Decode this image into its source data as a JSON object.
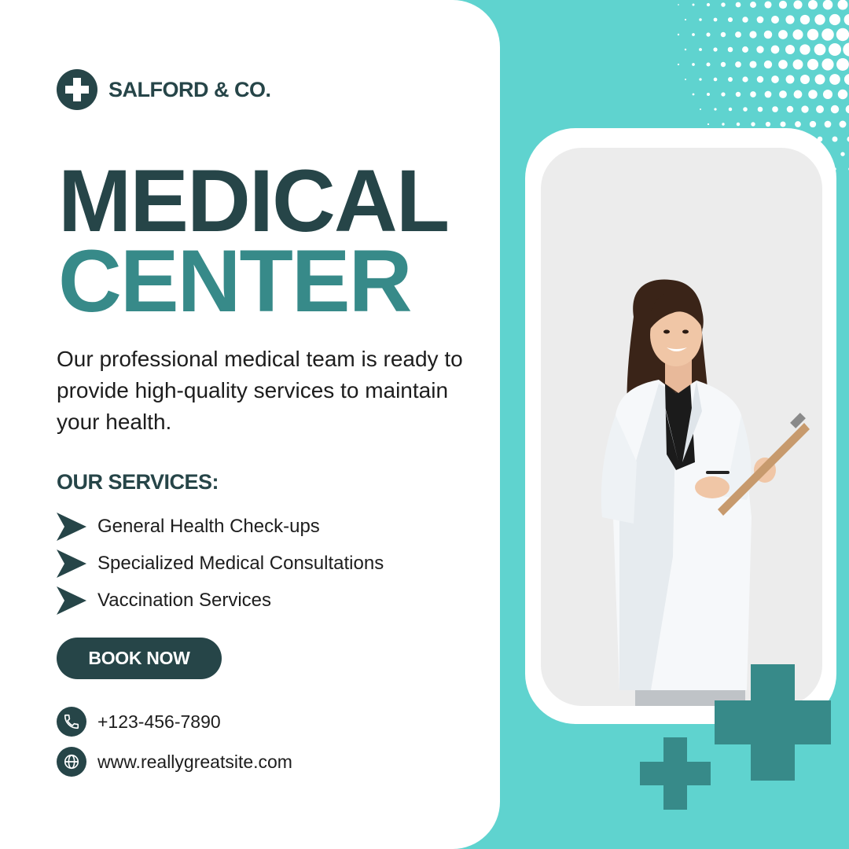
{
  "brand": {
    "name": "SALFORD & CO.",
    "logo_icon": "medical-cross-icon"
  },
  "hero": {
    "title_line1": "MEDICAL",
    "title_line2": "CENTER"
  },
  "description": "Our professional medical team is ready to provide high-quality services to maintain your health.",
  "services": {
    "heading": "OUR SERVICES:",
    "items": [
      "General Health Check-ups",
      "Specialized Medical Consultations",
      "Vaccination Services"
    ]
  },
  "cta": {
    "label": "BOOK NOW"
  },
  "contact": {
    "phone": "+123-456-7890",
    "website": "www.reallygreatsite.com"
  },
  "colors": {
    "dark_teal": "#264548",
    "mid_teal": "#378a89",
    "aqua_background": "#5fd3cf",
    "white": "#ffffff"
  }
}
